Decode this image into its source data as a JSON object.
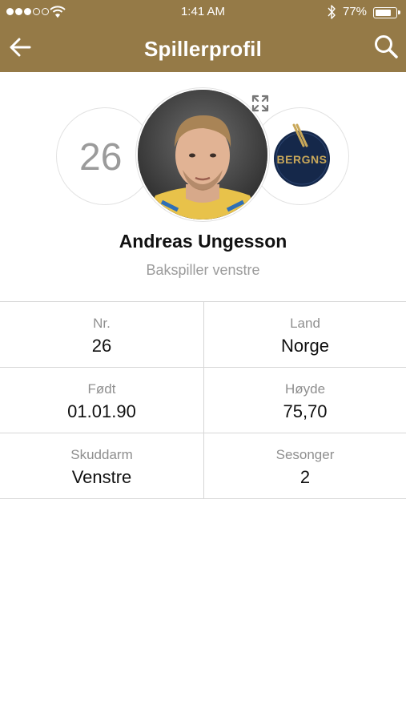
{
  "status_bar": {
    "time": "1:41 AM",
    "battery_percent": "77%",
    "battery_level": 0.77,
    "signal_bars_filled": 3,
    "signal_bars_total": 5
  },
  "navbar": {
    "title": "Spillerprofil",
    "back_icon": "arrow-left-icon",
    "search_icon": "search-icon"
  },
  "profile": {
    "number": "26",
    "name": "Andreas Ungesson",
    "position": "Bakspiller venstre",
    "club_logo_text": "BERGNS",
    "expand_icon": "expand-icon"
  },
  "stats": [
    {
      "left": {
        "label": "Nr.",
        "value": "26"
      },
      "right": {
        "label": "Land",
        "value": "Norge"
      }
    },
    {
      "left": {
        "label": "Født",
        "value": "01.01.90"
      },
      "right": {
        "label": "Høyde",
        "value": "75,70"
      }
    },
    {
      "left": {
        "label": "Skuddarm",
        "value": "Venstre"
      },
      "right": {
        "label": "Sesonger",
        "value": "2"
      }
    }
  ],
  "colors": {
    "header": "#957a47",
    "club_navy": "#15284a",
    "club_gold": "#c9a85a"
  }
}
